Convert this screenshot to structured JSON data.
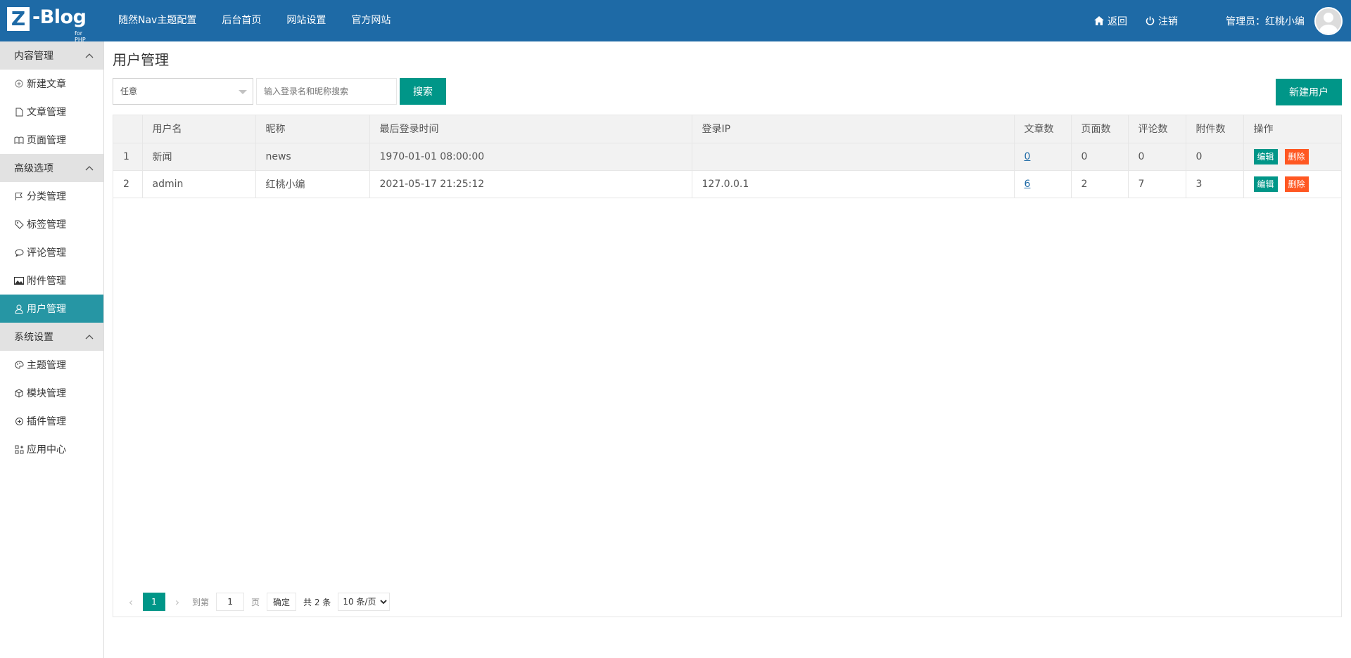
{
  "header": {
    "logo_mark": "Z",
    "logo_text": "-Blog",
    "logo_sub": "for PHP",
    "nav": [
      "随然Nav主题配置",
      "后台首页",
      "网站设置",
      "官方网站"
    ],
    "back_label": "返回",
    "logout_label": "注销",
    "admin_label": "管理员：红桃小编",
    "brand_color": "#1e6aa6"
  },
  "sidebar": {
    "groups": [
      {
        "title": "内容管理",
        "items": [
          {
            "label": "新建文章",
            "icon": "plus-circle-icon"
          },
          {
            "label": "文章管理",
            "icon": "file-icon"
          },
          {
            "label": "页面管理",
            "icon": "book-icon"
          }
        ]
      },
      {
        "title": "高级选项",
        "items": [
          {
            "label": "分类管理",
            "icon": "flag-icon"
          },
          {
            "label": "标签管理",
            "icon": "tag-icon"
          },
          {
            "label": "评论管理",
            "icon": "comment-icon"
          },
          {
            "label": "附件管理",
            "icon": "image-icon"
          },
          {
            "label": "用户管理",
            "icon": "user-icon",
            "active": true
          }
        ]
      },
      {
        "title": "系统设置",
        "items": [
          {
            "label": "主题管理",
            "icon": "palette-icon"
          },
          {
            "label": "模块管理",
            "icon": "cube-icon"
          },
          {
            "label": "插件管理",
            "icon": "plugin-icon"
          },
          {
            "label": "应用中心",
            "icon": "apps-icon"
          }
        ]
      }
    ],
    "active_color": "#2696a4"
  },
  "main": {
    "title": "用户管理",
    "filter_select": "任意",
    "search_placeholder": "输入登录名和昵称搜索",
    "search_btn": "搜索",
    "new_btn": "新建用户",
    "table": {
      "headers": [
        "",
        "用户名",
        "昵称",
        "最后登录时间",
        "登录IP",
        "文章数",
        "页面数",
        "评论数",
        "附件数",
        "操作"
      ],
      "rows": [
        {
          "id": "1",
          "username": "新闻",
          "nickname": "news",
          "last_login": "1970-01-01 08:00:00",
          "ip": "",
          "articles": "0",
          "pages": "0",
          "comments": "0",
          "attachments": "0"
        },
        {
          "id": "2",
          "username": "admin",
          "nickname": "红桃小编",
          "last_login": "2021-05-17 21:25:12",
          "ip": "127.0.0.1",
          "articles": "6",
          "pages": "2",
          "comments": "7",
          "attachments": "3"
        }
      ],
      "edit_label": "编辑",
      "delete_label": "删除"
    },
    "pager": {
      "current": "1",
      "goto_label": "到第",
      "page_value": "1",
      "page_unit": "页",
      "confirm": "确定",
      "total": "共 2 条",
      "per_page": "10 条/页"
    },
    "accent_color": "#009688",
    "danger_color": "#ff5722"
  }
}
